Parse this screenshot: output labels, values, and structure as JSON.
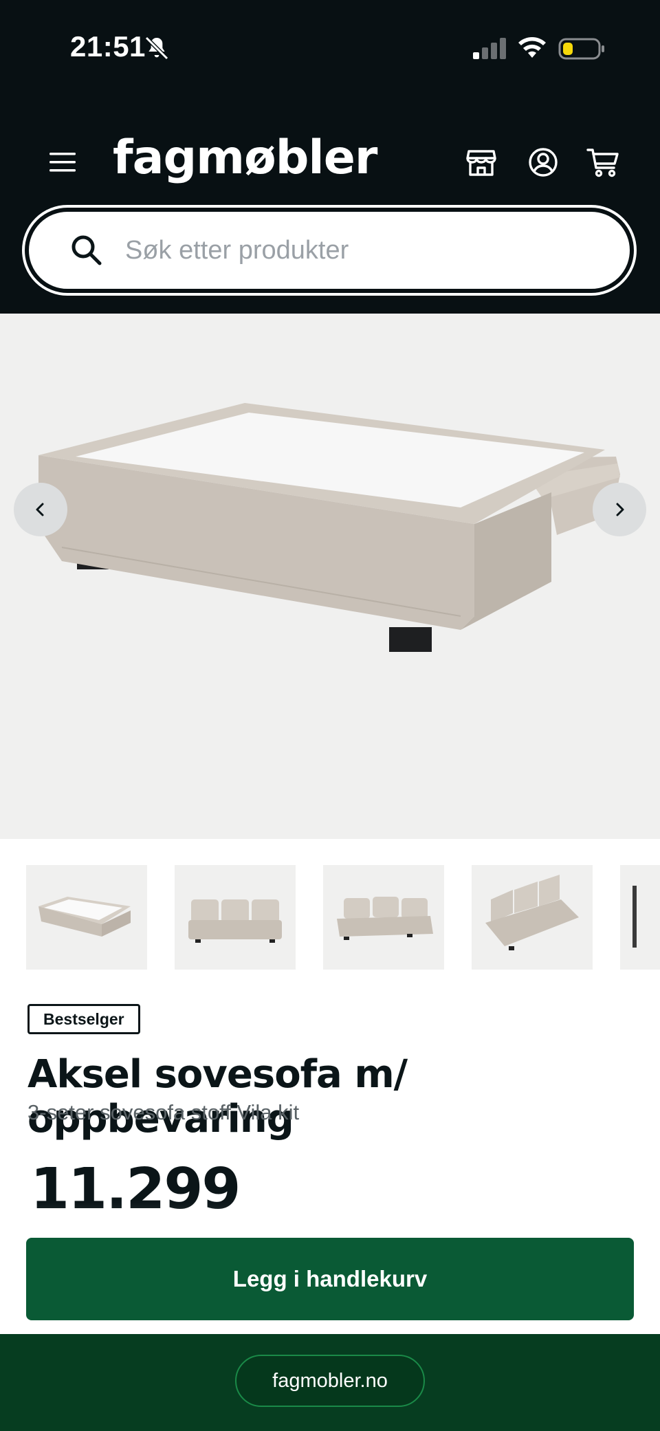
{
  "status_bar": {
    "time": "21:51"
  },
  "header": {
    "logo": "fagmøbler",
    "search_placeholder": "Søk etter produkter"
  },
  "product": {
    "badge": "Bestselger",
    "title": "Aksel sovesofa m/ oppbevaring",
    "subtitle": "3-seter sovesofa stoff Vila kit",
    "price": "11.299",
    "add_to_cart_label": "Legg i handlekurv"
  },
  "footer": {
    "url": "fagmobler.no"
  },
  "colors": {
    "header_bg": "#081013",
    "accent_green": "#0a5a35",
    "footer_bg": "#063d20",
    "image_bg": "#f0f0ef",
    "battery_low": "#f5d90a"
  },
  "icons": [
    "bell-slash-icon",
    "signal-icon",
    "wifi-icon",
    "battery-icon",
    "menu-icon",
    "store-icon",
    "user-icon",
    "cart-icon",
    "search-icon",
    "chevron-left-icon",
    "chevron-right-icon"
  ]
}
